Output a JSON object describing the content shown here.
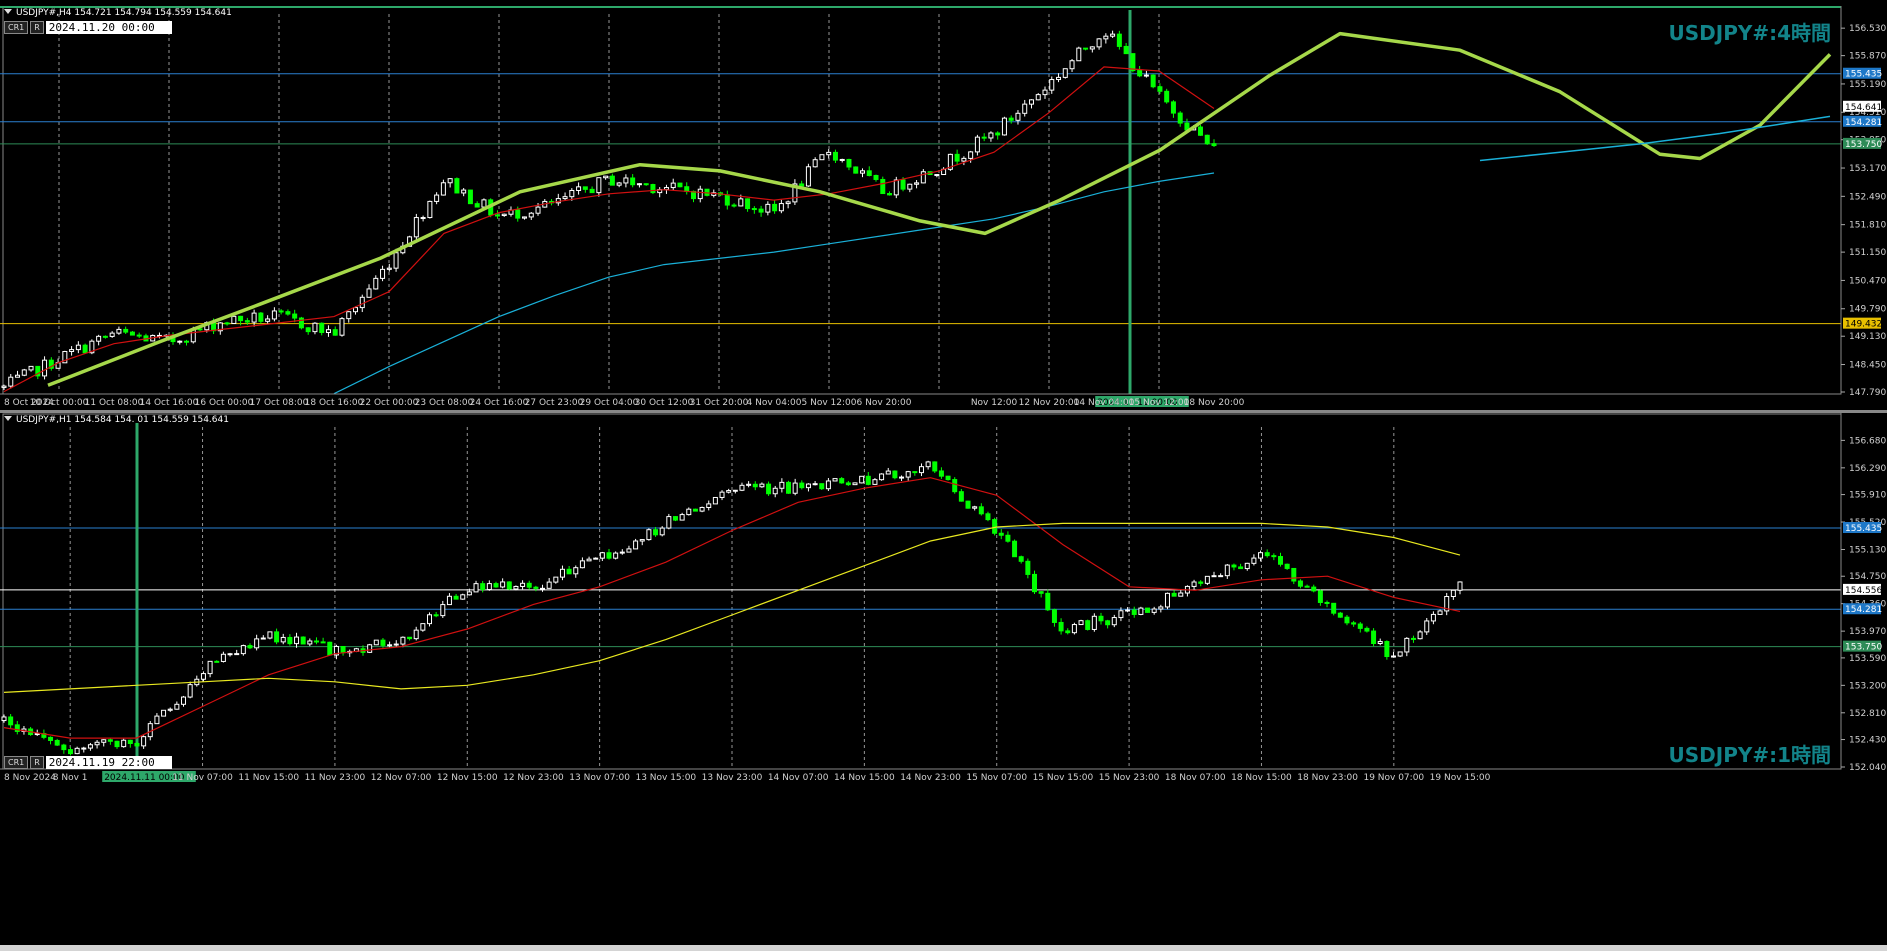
{
  "colors": {
    "background": "#000000",
    "candle_up": "#ffffff",
    "candle_down": "#00ff00",
    "grid": "#c8c8c8",
    "ma_fast": "#d01010",
    "ma_slow_h4": "#1ab0d8",
    "ma_slow_h1": "#e8e820",
    "forecast": "#a6d84a",
    "hline_blue": "#2a7fd0",
    "hline_green": "#2e8b57",
    "hline_yellow": "#e8c000",
    "hline_white": "#ffffff",
    "vline": "#2ea86a",
    "title": "#12848a"
  },
  "top_pane": {
    "header": "USDJPY#,H4  154.721 154.794 154.559 154.641",
    "cr_label": "CR1",
    "r_label": "R",
    "datetime": "2024.11.20 00:00",
    "title": "USDJPY#:4時間",
    "price_ticks": [
      "156.530",
      "155.870",
      "155.190",
      "154.510",
      "153.850",
      "153.170",
      "152.490",
      "151.810",
      "151.150",
      "150.470",
      "149.790",
      "149.130",
      "148.450",
      "147.790"
    ],
    "price_tags": [
      {
        "text": "155.435",
        "kind": "blue"
      },
      {
        "text": "154.641",
        "kind": "white"
      },
      {
        "text": "154.281",
        "kind": "blue"
      },
      {
        "text": "153.750",
        "kind": "green"
      },
      {
        "text": "149.432",
        "kind": "yellow"
      }
    ],
    "time_labels": [
      "8 Oct 2024",
      "10 Oct 00:00",
      "11 Oct 08:00",
      "14 Oct 16:00",
      "16 Oct 00:00",
      "17 Oct 08:00",
      "18 Oct 16:00",
      "22 Oct 00:00",
      "23 Oct 08:00",
      "24 Oct 16:00",
      "27 Oct 23:00",
      "29 Oct 04:00",
      "30 Oct 12:00",
      "31 Oct 20:00",
      "4 Nov 04:00",
      "5 Nov 12:00",
      "6 Nov 20:00",
      "2024.11.11 00:00",
      "Nov 12:00",
      "12 Nov 20:00",
      "14 Nov 04:00",
      "15 Nov 12:00",
      "18 Nov 20:00"
    ],
    "vline_label": "2024.11.11 00:00"
  },
  "bottom_pane": {
    "header": "USDJPY#,H1  154.584 154.  01 154.559 154.641",
    "cr_label": "CR1",
    "r_label": "R",
    "datetime": "2024.11.19 22:00",
    "title": "USDJPY#:1時間",
    "price_ticks": [
      "156.680",
      "156.290",
      "155.910",
      "155.520",
      "155.130",
      "154.750",
      "154.360",
      "153.970",
      "153.590",
      "153.200",
      "152.810",
      "152.430",
      "152.040"
    ],
    "price_tags": [
      {
        "text": "155.435",
        "kind": "blue"
      },
      {
        "text": "154.556",
        "kind": "white"
      },
      {
        "text": "154.281",
        "kind": "blue"
      },
      {
        "text": "153.750",
        "kind": "green"
      }
    ],
    "time_labels": [
      "8 Nov 2024",
      "8 Nov 1",
      "2024.11.11 00:00",
      "11 Nov 07:00",
      "11 Nov 15:00",
      "11 Nov 23:00",
      "12 Nov 07:00",
      "12 Nov 15:00",
      "12 Nov 23:00",
      "13 Nov 07:00",
      "13 Nov 15:00",
      "13 Nov 23:00",
      "14 Nov 07:00",
      "14 Nov 15:00",
      "14 Nov 23:00",
      "15 Nov 07:00",
      "15 Nov 15:00",
      "15 Nov 23:00",
      "18 Nov 07:00",
      "18 Nov 15:00",
      "18 Nov 23:00",
      "19 Nov 07:00",
      "19 Nov 15:00"
    ],
    "vline_label": "2024.11.11 00:00"
  },
  "chart_data": [
    {
      "type": "candlestick",
      "title": "USDJPY#:4時間",
      "symbol": "USDJPY#",
      "timeframe": "H4",
      "ylim": [
        147.79,
        156.87
      ],
      "x": [
        "8 Oct 2024",
        "10 Oct 00:00",
        "11 Oct 08:00",
        "14 Oct 16:00",
        "16 Oct 00:00",
        "17 Oct 08:00",
        "18 Oct 16:00",
        "22 Oct 00:00",
        "23 Oct 08:00",
        "24 Oct 16:00",
        "27 Oct 23:00",
        "29 Oct 04:00",
        "30 Oct 12:00",
        "31 Oct 20:00",
        "4 Nov 04:00",
        "5 Nov 12:00",
        "6 Nov 20:00",
        "11 Nov 00:00",
        "Nov 12:00",
        "12 Nov 20:00",
        "14 Nov 04:00",
        "15 Nov 12:00",
        "18 Nov 20:00"
      ],
      "close_path": [
        147.9,
        148.6,
        149.2,
        149.0,
        149.5,
        149.6,
        149.2,
        150.9,
        152.9,
        152.0,
        152.3,
        152.9,
        152.7,
        152.5,
        152.1,
        153.6,
        152.6,
        153.2,
        154.0,
        155.2,
        156.5,
        154.9,
        153.6
      ],
      "horizontal_levels": [
        155.435,
        154.281,
        153.75,
        149.432
      ],
      "last_price": 154.641,
      "series": [
        {
          "name": "MA fast",
          "values": [
            147.8,
            148.5,
            148.95,
            149.15,
            149.3,
            149.45,
            149.6,
            150.2,
            151.6,
            152.1,
            152.35,
            152.55,
            152.65,
            152.55,
            152.4,
            152.55,
            152.8,
            153.1,
            153.55,
            154.5,
            155.6,
            155.5,
            154.6
          ]
        },
        {
          "name": "MA slow",
          "values": [
            null,
            null,
            null,
            null,
            null,
            null,
            147.75,
            148.4,
            149.0,
            149.6,
            150.1,
            150.55,
            150.85,
            151.0,
            151.15,
            151.35,
            151.55,
            151.75,
            151.95,
            152.25,
            152.6,
            152.85,
            153.05
          ]
        }
      ]
    },
    {
      "type": "candlestick",
      "title": "USDJPY#:1時間",
      "symbol": "USDJPY#",
      "timeframe": "H1",
      "ylim": [
        152.04,
        156.87
      ],
      "x": [
        "8 Nov 2024",
        "8 Nov 1",
        "11 Nov 00:00",
        "11 Nov 07:00",
        "11 Nov 15:00",
        "11 Nov 23:00",
        "12 Nov 07:00",
        "12 Nov 15:00",
        "12 Nov 23:00",
        "13 Nov 07:00",
        "13 Nov 15:00",
        "13 Nov 23:00",
        "14 Nov 07:00",
        "14 Nov 15:00",
        "14 Nov 23:00",
        "15 Nov 07:00",
        "15 Nov 15:00",
        "15 Nov 23:00",
        "18 Nov 07:00",
        "18 Nov 15:00",
        "18 Nov 23:00",
        "19 Nov 07:00",
        "19 Nov 15:00"
      ],
      "close_path": [
        152.7,
        152.3,
        152.4,
        153.4,
        153.9,
        153.7,
        153.8,
        154.6,
        154.6,
        155.0,
        155.5,
        156.0,
        156.0,
        156.1,
        156.3,
        155.4,
        154.0,
        154.2,
        154.6,
        155.1,
        154.3,
        153.6,
        154.6
      ],
      "horizontal_levels": [
        155.435,
        154.281,
        153.75
      ],
      "last_price": 154.556,
      "series": [
        {
          "name": "MA fast",
          "values": [
            152.6,
            152.45,
            152.45,
            152.9,
            153.35,
            153.65,
            153.75,
            154.0,
            154.35,
            154.6,
            154.95,
            155.4,
            155.8,
            156.0,
            156.15,
            155.9,
            155.2,
            154.6,
            154.55,
            154.7,
            154.75,
            154.45,
            154.25
          ]
        },
        {
          "name": "MA slow",
          "values": [
            153.1,
            153.15,
            153.2,
            153.25,
            153.3,
            153.25,
            153.15,
            153.2,
            153.35,
            153.55,
            153.85,
            154.2,
            154.55,
            154.9,
            155.25,
            155.45,
            155.5,
            155.5,
            155.5,
            155.5,
            155.45,
            155.3,
            155.05
          ]
        }
      ]
    }
  ]
}
